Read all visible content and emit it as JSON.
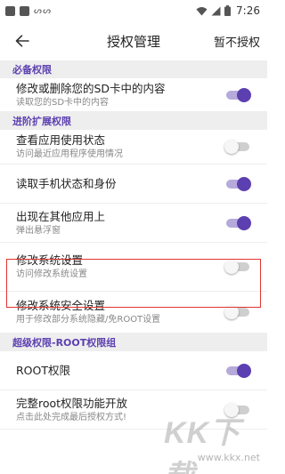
{
  "status_bar": {
    "glyphs": "ᔕ ᔕ",
    "time": "7:26",
    "icons": [
      "wifi-icon",
      "signal-icon",
      "battery-icon"
    ]
  },
  "appbar": {
    "title": "授权管理",
    "action_label": "暂不授权"
  },
  "sections": [
    {
      "label": "必备权限"
    },
    {
      "label": "进阶扩展权限"
    },
    {
      "label": "超级权限-ROOT权限组"
    }
  ],
  "rows": [
    {
      "title": "修改或删除您的SD卡中的内容",
      "subtitle": "读取您的SD卡中的内容",
      "enabled": true
    },
    {
      "title": "查看应用使用状态",
      "subtitle": "访问最近应用程序使用情况",
      "enabled": false
    },
    {
      "title": "读取手机状态和身份",
      "subtitle": "",
      "enabled": true
    },
    {
      "title": "出现在其他应用上",
      "subtitle": "弹出悬浮窗",
      "enabled": true
    },
    {
      "title": "修改系统设置",
      "subtitle": "访问修改系统设置",
      "enabled": false
    },
    {
      "title": "修改系统安全设置",
      "subtitle": "用于修改部分系统隐藏/免ROOT设置",
      "enabled": false
    },
    {
      "title": "ROOT权限",
      "subtitle": "",
      "enabled": true
    },
    {
      "title": "完整root权限功能开放",
      "subtitle": "点击此处完成最后授权方式!",
      "enabled": false
    }
  ],
  "watermark": {
    "text": "KK下载",
    "url": "www.kkx.net"
  },
  "colors": {
    "accent": "#5c3fb0",
    "section_bg": "#eeeeee",
    "highlight": "#e3342f"
  }
}
